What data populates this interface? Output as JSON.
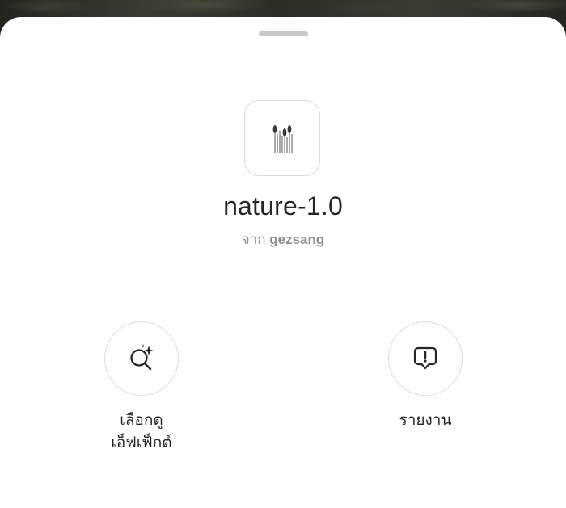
{
  "effect": {
    "name": "nature-1.0",
    "creator_prefix": "จาก",
    "creator": "gezsang",
    "thumbnail_icon": "reed-grass-icon"
  },
  "actions": [
    {
      "id": "browse",
      "label_line1": "เลือกดู",
      "label_line2": "เอ็ฟเฟ็กต์",
      "icon": "search-sparkle-icon"
    },
    {
      "id": "report",
      "label_line1": "รายงาน",
      "icon": "report-exclamation-icon"
    }
  ],
  "colors": {
    "text_primary": "#262626",
    "text_secondary": "#8e8e8e",
    "border": "#dbdbdb",
    "handle": "#c8c8c8"
  }
}
